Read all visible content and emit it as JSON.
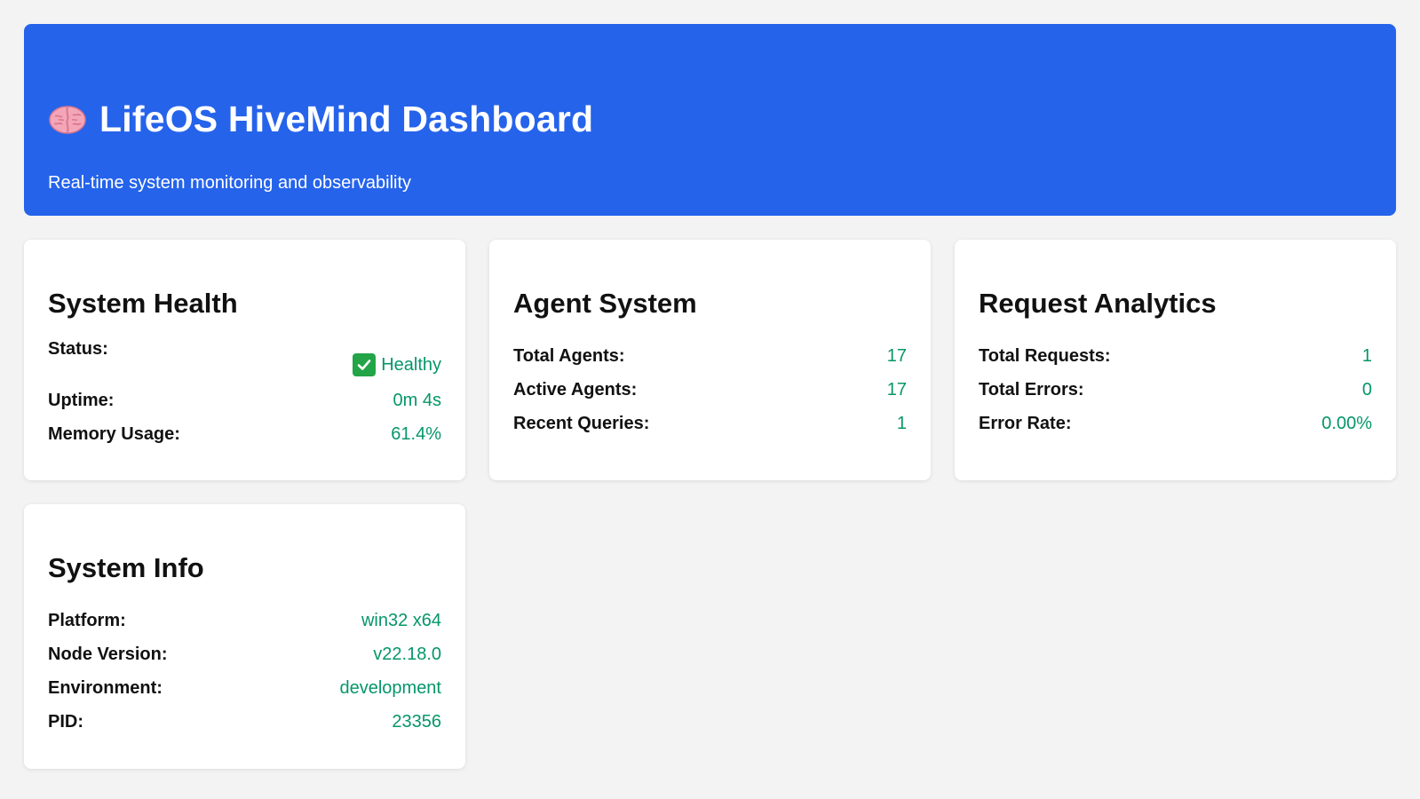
{
  "header": {
    "icon": "brain-icon",
    "title": "LifeOS HiveMind Dashboard",
    "subtitle": "Real-time system monitoring and observability"
  },
  "colors": {
    "header_bg": "#2563eb",
    "value_green": "#059669",
    "page_bg": "#f3f3f3"
  },
  "cards": {
    "system_health": {
      "title": "System Health",
      "rows": [
        {
          "label": "Status:",
          "value": "Healthy",
          "icon": "check-icon"
        },
        {
          "label": "Uptime:",
          "value": "0m 4s"
        },
        {
          "label": "Memory Usage:",
          "value": "61.4%"
        }
      ]
    },
    "agent_system": {
      "title": "Agent System",
      "rows": [
        {
          "label": "Total Agents:",
          "value": "17"
        },
        {
          "label": "Active Agents:",
          "value": "17"
        },
        {
          "label": "Recent Queries:",
          "value": "1"
        }
      ]
    },
    "request_analytics": {
      "title": "Request Analytics",
      "rows": [
        {
          "label": "Total Requests:",
          "value": "1"
        },
        {
          "label": "Total Errors:",
          "value": "0"
        },
        {
          "label": "Error Rate:",
          "value": "0.00%"
        }
      ]
    },
    "system_info": {
      "title": "System Info",
      "rows": [
        {
          "label": "Platform:",
          "value": "win32 x64"
        },
        {
          "label": "Node Version:",
          "value": "v22.18.0"
        },
        {
          "label": "Environment:",
          "value": "development"
        },
        {
          "label": "PID:",
          "value": "23356"
        }
      ]
    }
  }
}
